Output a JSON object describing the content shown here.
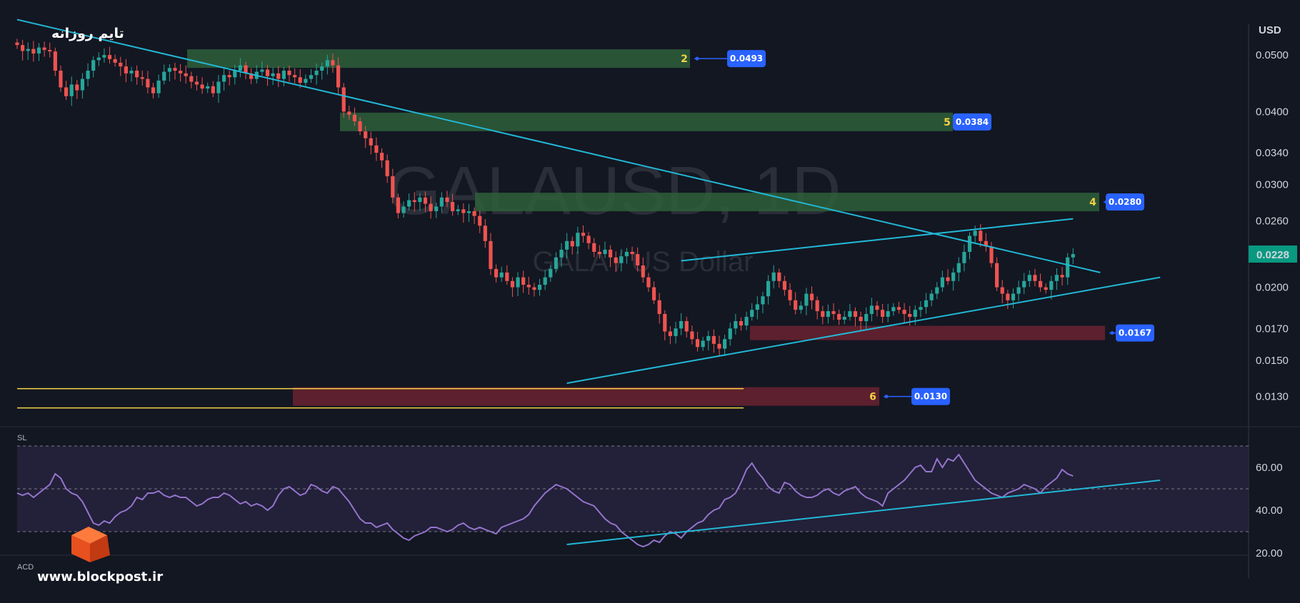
{
  "header": {
    "timeframe_title": "تایم روزانه",
    "currency": "USD"
  },
  "watermark": {
    "symbol": "GALAUSD, 1D",
    "description": "GALA / US Dollar"
  },
  "branding": {
    "site": "www.blockpost.ir",
    "logo_icon": "orange-cube-icon"
  },
  "price_axis": {
    "ticks": [
      "0.0500",
      "0.0400",
      "0.0340",
      "0.0300",
      "0.0260",
      "0.0200",
      "0.0170",
      "0.0150",
      "0.0130"
    ],
    "current_price": "0.0228"
  },
  "rsi_axis": {
    "pane_label": "SL",
    "ticks": [
      "60.00",
      "40.00",
      "20.00"
    ]
  },
  "macd": {
    "pane_label": "ACD"
  },
  "zones": [
    {
      "number": "2",
      "price": "0.0493",
      "kind": "resistance"
    },
    {
      "number": "5",
      "price": "0.0384",
      "kind": "resistance"
    },
    {
      "number": "4",
      "price": "0.0280",
      "kind": "resistance"
    },
    {
      "number": "",
      "price": "0.0167",
      "kind": "support"
    },
    {
      "number": "6",
      "price": "0.0130",
      "kind": "support"
    }
  ],
  "colors": {
    "background": "#131722",
    "bull": "#26a69a",
    "bear": "#ef5350",
    "trendline": "#22b8d6",
    "rsi_line": "#9575cd",
    "resistance_zone": "#2e5f3a",
    "support_zone": "#6b2230",
    "price_tag": "#2962ff",
    "current_price_tag": "#089981",
    "zone_number": "#f5d442",
    "yellow_line": "#f5d442"
  },
  "chart_data": {
    "type": "candlestick",
    "symbol": "GALAUSD",
    "interval": "1D",
    "y_scale": "log",
    "ylim": [
      0.0118,
      0.0555
    ],
    "closes": [
      0.052,
      0.0508,
      0.0512,
      0.0503,
      0.0515,
      0.051,
      0.0507,
      0.047,
      0.044,
      0.0425,
      0.0445,
      0.0435,
      0.0455,
      0.047,
      0.049,
      0.0495,
      0.05,
      0.0492,
      0.0485,
      0.0478,
      0.0465,
      0.047,
      0.0458,
      0.0455,
      0.044,
      0.043,
      0.0452,
      0.0468,
      0.0475,
      0.047,
      0.0465,
      0.046,
      0.045,
      0.0445,
      0.0438,
      0.0442,
      0.043,
      0.045,
      0.0462,
      0.0458,
      0.047,
      0.048,
      0.0465,
      0.0455,
      0.0468,
      0.0472,
      0.046,
      0.0465,
      0.0455,
      0.047,
      0.0462,
      0.0458,
      0.0448,
      0.0455,
      0.0462,
      0.047,
      0.0478,
      0.049,
      0.048,
      0.044,
      0.04,
      0.0395,
      0.0385,
      0.037,
      0.036,
      0.035,
      0.034,
      0.033,
      0.031,
      0.0285,
      0.0268,
      0.0275,
      0.0282,
      0.028,
      0.0285,
      0.0278,
      0.027,
      0.0275,
      0.0285,
      0.028,
      0.027,
      0.0272,
      0.0268,
      0.027,
      0.0265,
      0.0255,
      0.024,
      0.0215,
      0.0208,
      0.0212,
      0.0205,
      0.02,
      0.0208,
      0.0202,
      0.02,
      0.0198,
      0.0202,
      0.0208,
      0.0215,
      0.0225,
      0.0232,
      0.024,
      0.0235,
      0.0248,
      0.0245,
      0.0238,
      0.023,
      0.0228,
      0.0232,
      0.0225,
      0.022,
      0.0226,
      0.023,
      0.0228,
      0.0218,
      0.0208,
      0.02,
      0.019,
      0.018,
      0.0168,
      0.0165,
      0.017,
      0.0175,
      0.0168,
      0.0163,
      0.0158,
      0.0162,
      0.0165,
      0.016,
      0.0157,
      0.0163,
      0.017,
      0.0175,
      0.0172,
      0.0178,
      0.0183,
      0.0187,
      0.0193,
      0.0205,
      0.0212,
      0.0205,
      0.0198,
      0.019,
      0.0183,
      0.0186,
      0.0195,
      0.019,
      0.0182,
      0.0178,
      0.0182,
      0.018,
      0.0176,
      0.0178,
      0.0182,
      0.0178,
      0.0175,
      0.018,
      0.0186,
      0.0183,
      0.0178,
      0.0182,
      0.0185,
      0.0183,
      0.018,
      0.0178,
      0.0183,
      0.0185,
      0.019,
      0.0195,
      0.02,
      0.0208,
      0.0205,
      0.0212,
      0.022,
      0.023,
      0.0245,
      0.025,
      0.024,
      0.0235,
      0.022,
      0.02,
      0.0195,
      0.019,
      0.0195,
      0.02,
      0.0205,
      0.021,
      0.0205,
      0.02,
      0.0198,
      0.0205,
      0.021,
      0.0208,
      0.0225,
      0.0228
    ],
    "trendlines": [
      {
        "name": "descending-resistance",
        "from": [
          0,
          0.0575
        ],
        "to": [
          199,
          0.0212
        ]
      },
      {
        "name": "channel-upper",
        "from": [
          122,
          0.0222
        ],
        "to": [
          194,
          0.0262
        ]
      },
      {
        "name": "channel-lower",
        "from": [
          101,
          0.0137
        ],
        "to": [
          210,
          0.0208
        ]
      }
    ],
    "rsi": {
      "ylim": [
        15,
        75
      ],
      "overbought": 70,
      "mid": 50,
      "oversold": 30,
      "values": [
        48,
        47,
        48,
        46,
        48,
        50,
        52,
        57,
        55,
        50,
        48,
        47,
        44,
        39,
        34,
        33,
        35,
        34,
        37,
        39,
        40,
        42,
        46,
        45,
        48,
        48,
        49,
        47,
        46,
        47,
        46,
        46,
        44,
        42,
        43,
        45,
        46,
        46,
        48,
        47,
        45,
        43,
        44,
        42,
        43,
        42,
        40,
        42,
        47,
        50,
        51,
        49,
        47,
        48,
        52,
        51,
        49,
        48,
        51,
        50,
        47,
        44,
        40,
        36,
        34,
        34,
        32,
        33,
        34,
        31,
        29,
        27,
        26,
        28,
        29,
        30,
        32,
        32,
        31,
        30,
        31,
        33,
        34,
        32,
        31,
        32,
        31,
        30,
        29,
        32,
        33,
        34,
        35,
        36,
        38,
        42,
        45,
        48,
        50,
        52,
        51,
        50,
        48,
        46,
        44,
        43,
        42,
        39,
        36,
        34,
        33,
        30,
        28,
        26,
        24,
        23,
        24,
        26,
        25,
        28,
        30,
        29,
        27,
        30,
        32,
        34,
        35,
        38,
        40,
        41,
        45,
        46,
        48,
        53,
        59,
        62,
        58,
        55,
        51,
        49,
        48,
        53,
        52,
        49,
        47,
        46,
        46,
        47,
        49,
        50,
        48,
        47,
        49,
        50,
        51,
        48,
        46,
        45,
        44,
        42,
        48,
        50,
        52,
        54,
        57,
        60,
        61,
        58,
        58,
        64,
        60,
        64,
        63,
        66,
        62,
        58,
        54,
        52,
        50,
        48,
        47,
        46,
        48,
        49,
        50,
        52,
        51,
        50,
        48,
        51,
        53,
        55,
        59,
        57,
        56
      ]
    },
    "rsi_trendline": {
      "from": [
        101,
        24
      ],
      "to": [
        210,
        54
      ]
    }
  }
}
